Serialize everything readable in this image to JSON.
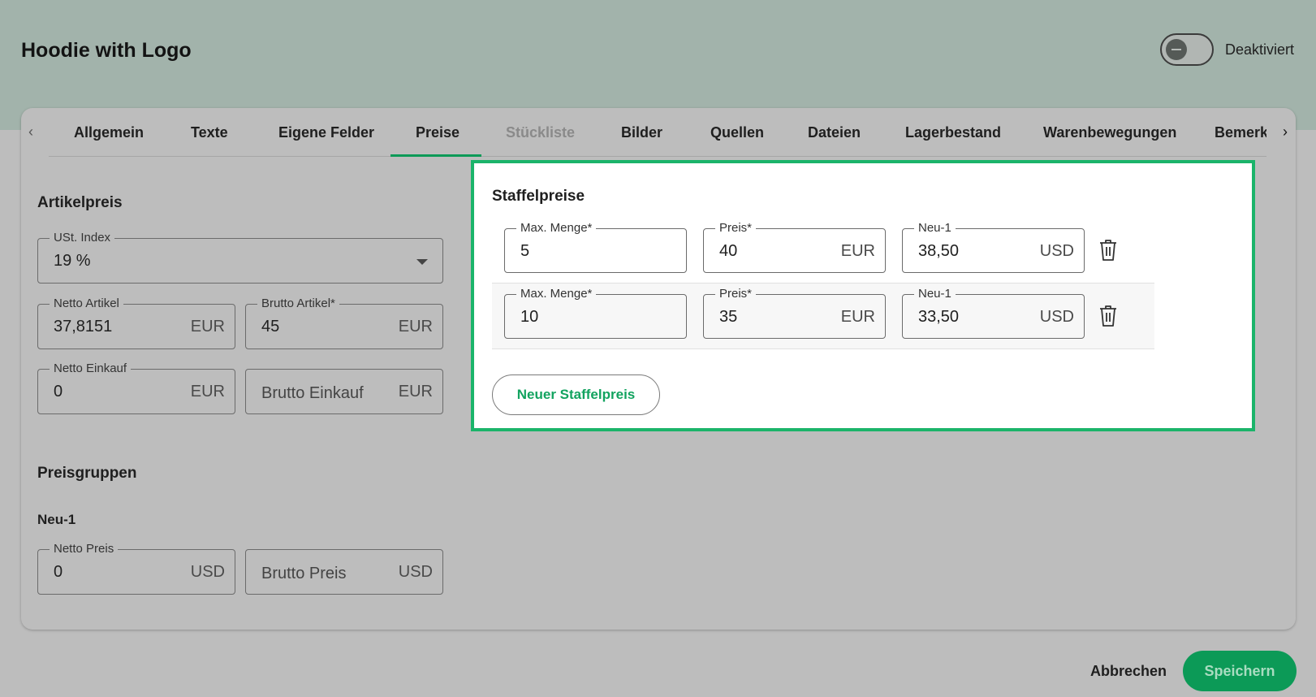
{
  "header": {
    "title": "Hoodie with Logo",
    "status_toggle_label": "Deaktiviert",
    "status_active": false
  },
  "tabs": [
    {
      "label": "Allgemein",
      "disabled": false,
      "active": false
    },
    {
      "label": "Texte",
      "disabled": false,
      "active": false
    },
    {
      "label": "Eigene Felder",
      "disabled": false,
      "active": false
    },
    {
      "label": "Preise",
      "disabled": false,
      "active": true
    },
    {
      "label": "Stückliste",
      "disabled": true,
      "active": false
    },
    {
      "label": "Bilder",
      "disabled": false,
      "active": false
    },
    {
      "label": "Quellen",
      "disabled": false,
      "active": false
    },
    {
      "label": "Dateien",
      "disabled": false,
      "active": false
    },
    {
      "label": "Lagerbestand",
      "disabled": false,
      "active": false
    },
    {
      "label": "Warenbewegungen",
      "disabled": false,
      "active": false
    },
    {
      "label": "Bemerkungen",
      "disabled": false,
      "active": false
    }
  ],
  "article_price": {
    "title": "Artikelpreis",
    "vat_index": {
      "label": "USt. Index",
      "value": "19 %"
    },
    "net_article": {
      "label": "Netto Artikel",
      "value": "37,8151",
      "unit": "EUR"
    },
    "gross_article": {
      "label": "Brutto Artikel*",
      "value": "45",
      "unit": "EUR"
    },
    "net_purchase": {
      "label": "Netto Einkauf",
      "value": "0",
      "unit": "EUR"
    },
    "gross_purchase": {
      "placeholder": "Brutto Einkauf",
      "unit": "EUR"
    }
  },
  "price_groups": {
    "title": "Preisgruppen",
    "group_name": "Neu-1",
    "net_price": {
      "label": "Netto Preis",
      "value": "0",
      "unit": "USD"
    },
    "gross_price": {
      "placeholder": "Brutto Preis",
      "unit": "USD"
    }
  },
  "tier_prices": {
    "title": "Staffelpreise",
    "rows": [
      {
        "max_qty": {
          "label": "Max. Menge*",
          "value": "5"
        },
        "price": {
          "label": "Preis*",
          "value": "40",
          "unit": "EUR"
        },
        "group_price": {
          "label": "Neu-1",
          "value": "38,50",
          "unit": "USD"
        }
      },
      {
        "max_qty": {
          "label": "Max. Menge*",
          "value": "10"
        },
        "price": {
          "label": "Preis*",
          "value": "35",
          "unit": "EUR"
        },
        "group_price": {
          "label": "Neu-1",
          "value": "33,50",
          "unit": "USD"
        }
      }
    ],
    "new_button_label": "Neuer Staffelpreis"
  },
  "footer": {
    "cancel_label": "Abbrechen",
    "save_label": "Speichern"
  },
  "colors": {
    "accent": "#0c9a57",
    "highlight_border": "#1bb46a",
    "header_band": "#a2b3ab"
  }
}
